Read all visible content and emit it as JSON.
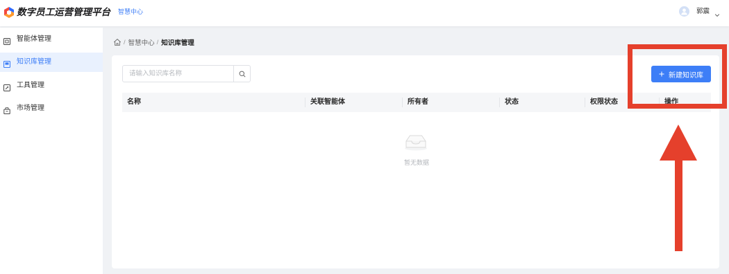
{
  "header": {
    "logo_icon": "platform-logo-icon",
    "app_title": "数字员工运营管理平台",
    "nav_link": "智慧中心",
    "user": {
      "avatar_icon": "user-avatar-icon",
      "name": "郭震",
      "dropdown_icon": "chevron-down-icon"
    }
  },
  "sidebar": {
    "items": [
      {
        "label": "智能体管理",
        "icon": "agent-icon",
        "active": false
      },
      {
        "label": "知识库管理",
        "icon": "book-icon",
        "active": true
      },
      {
        "label": "工具管理",
        "icon": "tool-icon",
        "active": false
      },
      {
        "label": "市场管理",
        "icon": "shop-icon",
        "active": false
      }
    ]
  },
  "breadcrumb": {
    "home_icon": "home-icon",
    "separator": "/",
    "items": [
      "智慧中心",
      "知识库管理"
    ]
  },
  "toolbar": {
    "search": {
      "placeholder": "请输入知识库名称",
      "value": "",
      "icon": "search-icon"
    },
    "create_button": {
      "icon": "plus-icon",
      "label": "新建知识库"
    }
  },
  "table": {
    "columns": [
      "名称",
      "关联智能体",
      "所有者",
      "状态",
      "权限状态",
      "操作"
    ],
    "rows": [],
    "empty": {
      "icon": "empty-inbox-icon",
      "text": "暂无数据"
    }
  },
  "colors": {
    "accent": "#3d7ef7",
    "sidebar_active_bg": "#e9f1fe",
    "page_bg": "#f0f2f5",
    "annotation": "#e5402c"
  }
}
